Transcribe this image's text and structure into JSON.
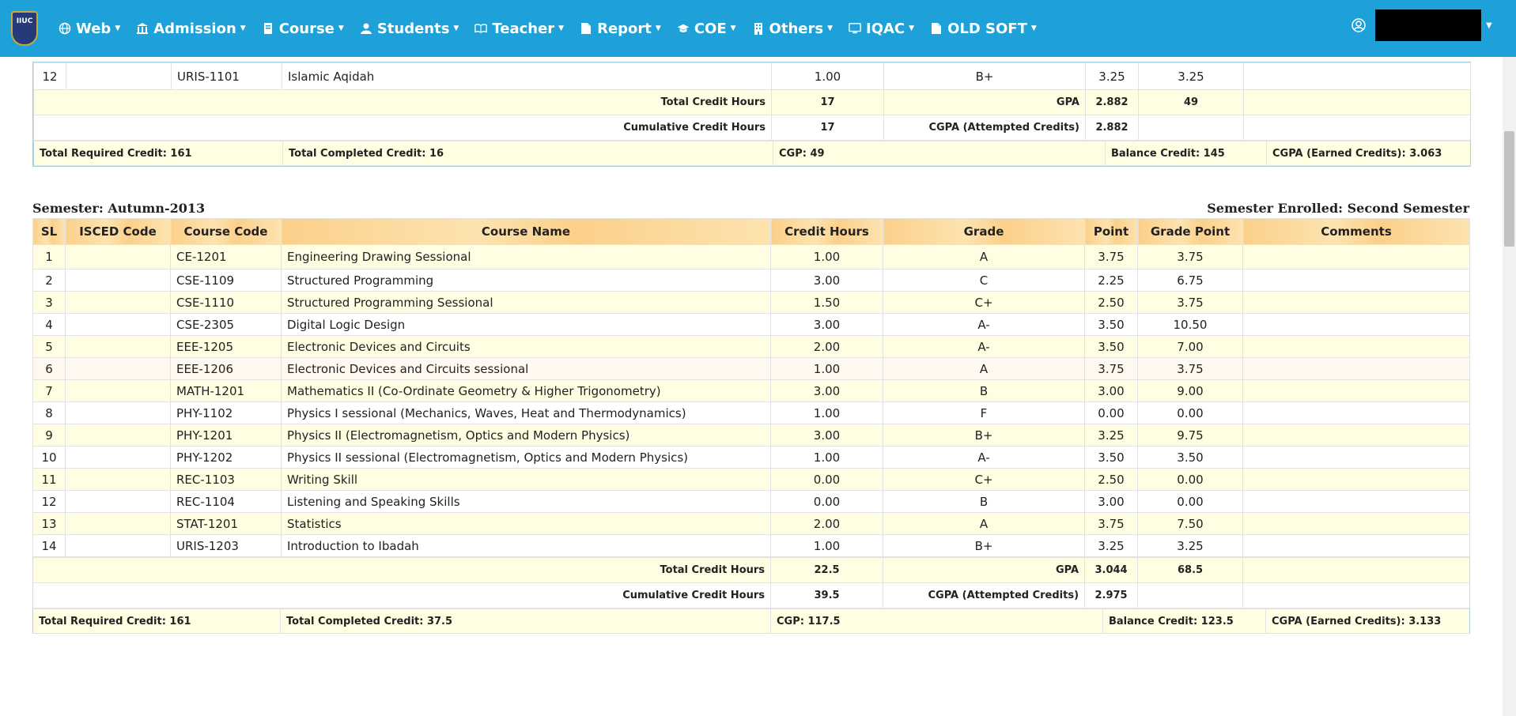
{
  "nav": {
    "logo_text": "IIUC",
    "items": [
      {
        "label": "Web",
        "icon": "globe-icon"
      },
      {
        "label": "Admission",
        "icon": "institution-icon"
      },
      {
        "label": "Course",
        "icon": "book-icon"
      },
      {
        "label": "Students",
        "icon": "user-icon"
      },
      {
        "label": "Teacher",
        "icon": "open-book-icon"
      },
      {
        "label": "Report",
        "icon": "file-icon"
      },
      {
        "label": "COE",
        "icon": "graduation-cap-icon"
      },
      {
        "label": "Others",
        "icon": "building-icon"
      },
      {
        "label": "IQAC",
        "icon": "monitor-icon"
      },
      {
        "label": "OLD SOFT",
        "icon": "file-icon"
      }
    ]
  },
  "prev": {
    "row": {
      "sl": "12",
      "isced": "",
      "code": "URIS-1101",
      "name": "Islamic Aqidah",
      "credit": "1.00",
      "grade": "B+",
      "point": "3.25",
      "grade_point": "3.25",
      "comments": ""
    },
    "total_credit_label": "Total Credit Hours",
    "total_credit": "17",
    "gpa_label": "GPA",
    "gpa": "2.882",
    "gpa_points": "49",
    "cum_label": "Cumulative Credit Hours",
    "cum_credit": "17",
    "cgpa_att_label": "CGPA (Attempted Credits)",
    "cgpa_att": "2.882",
    "footer": {
      "required": "Total Required Credit: 161",
      "completed": "Total Completed Credit: 16",
      "cgp": "CGP: 49",
      "balance": "Balance Credit: 145",
      "cgpa_earned": "CGPA (Earned Credits): 3.063"
    }
  },
  "semester": {
    "title": "Semester: Autumn-2013",
    "enrolled": "Semester Enrolled: Second Semester",
    "headers": {
      "sl": "SL",
      "isced": "ISCED Code",
      "code": "Course Code",
      "name": "Course Name",
      "credit": "Credit Hours",
      "grade": "Grade",
      "point": "Point",
      "grade_point": "Grade Point",
      "comments": "Comments"
    },
    "rows": [
      {
        "sl": "1",
        "isced": "",
        "code": "CE-1201",
        "name": "Engineering Drawing Sessional",
        "credit": "1.00",
        "grade": "A",
        "point": "3.75",
        "grade_point": "3.75",
        "comments": ""
      },
      {
        "sl": "2",
        "isced": "",
        "code": "CSE-1109",
        "name": "Structured Programming",
        "credit": "3.00",
        "grade": "C",
        "point": "2.25",
        "grade_point": "6.75",
        "comments": ""
      },
      {
        "sl": "3",
        "isced": "",
        "code": "CSE-1110",
        "name": "Structured Programming Sessional",
        "credit": "1.50",
        "grade": "C+",
        "point": "2.50",
        "grade_point": "3.75",
        "comments": ""
      },
      {
        "sl": "4",
        "isced": "",
        "code": "CSE-2305",
        "name": "Digital Logic Design",
        "credit": "3.00",
        "grade": "A-",
        "point": "3.50",
        "grade_point": "10.50",
        "comments": ""
      },
      {
        "sl": "5",
        "isced": "",
        "code": "EEE-1205",
        "name": "Electronic Devices and Circuits",
        "credit": "2.00",
        "grade": "A-",
        "point": "3.50",
        "grade_point": "7.00",
        "comments": ""
      },
      {
        "sl": "6",
        "isced": "",
        "code": "EEE-1206",
        "name": "Electronic Devices and Circuits sessional",
        "credit": "1.00",
        "grade": "A",
        "point": "3.75",
        "grade_point": "3.75",
        "comments": ""
      },
      {
        "sl": "7",
        "isced": "",
        "code": "MATH-1201",
        "name": "Mathematics II (Co-Ordinate Geometry & Higher Trigonometry)",
        "credit": "3.00",
        "grade": "B",
        "point": "3.00",
        "grade_point": "9.00",
        "comments": ""
      },
      {
        "sl": "8",
        "isced": "",
        "code": "PHY-1102",
        "name": "Physics I sessional (Mechanics, Waves, Heat and Thermodynamics)",
        "credit": "1.00",
        "grade": "F",
        "point": "0.00",
        "grade_point": "0.00",
        "comments": ""
      },
      {
        "sl": "9",
        "isced": "",
        "code": "PHY-1201",
        "name": "Physics II (Electromagnetism, Optics and Modern Physics)",
        "credit": "3.00",
        "grade": "B+",
        "point": "3.25",
        "grade_point": "9.75",
        "comments": ""
      },
      {
        "sl": "10",
        "isced": "",
        "code": "PHY-1202",
        "name": "Physics II sessional (Electromagnetism, Optics and Modern Physics)",
        "credit": "1.00",
        "grade": "A-",
        "point": "3.50",
        "grade_point": "3.50",
        "comments": ""
      },
      {
        "sl": "11",
        "isced": "",
        "code": "REC-1103",
        "name": "Writing Skill",
        "credit": "0.00",
        "grade": "C+",
        "point": "2.50",
        "grade_point": "0.00",
        "comments": ""
      },
      {
        "sl": "12",
        "isced": "",
        "code": "REC-1104",
        "name": "Listening and Speaking Skills",
        "credit": "0.00",
        "grade": "B",
        "point": "3.00",
        "grade_point": "0.00",
        "comments": ""
      },
      {
        "sl": "13",
        "isced": "",
        "code": "STAT-1201",
        "name": "Statistics",
        "credit": "2.00",
        "grade": "A",
        "point": "3.75",
        "grade_point": "7.50",
        "comments": ""
      },
      {
        "sl": "14",
        "isced": "",
        "code": "URIS-1203",
        "name": "Introduction to Ibadah",
        "credit": "1.00",
        "grade": "B+",
        "point": "3.25",
        "grade_point": "3.25",
        "comments": ""
      }
    ],
    "total_credit_label": "Total Credit Hours",
    "total_credit": "22.5",
    "gpa_label": "GPA",
    "gpa": "3.044",
    "gpa_points": "68.5",
    "cum_label": "Cumulative Credit Hours",
    "cum_credit": "39.5",
    "cgpa_att_label": "CGPA (Attempted Credits)",
    "cgpa_att": "2.975",
    "footer": {
      "required": "Total Required Credit: 161",
      "completed": "Total Completed Credit: 37.5",
      "cgp": "CGP: 117.5",
      "balance": "Balance Credit: 123.5",
      "cgpa_earned": "CGPA (Earned Credits): 3.133"
    }
  }
}
